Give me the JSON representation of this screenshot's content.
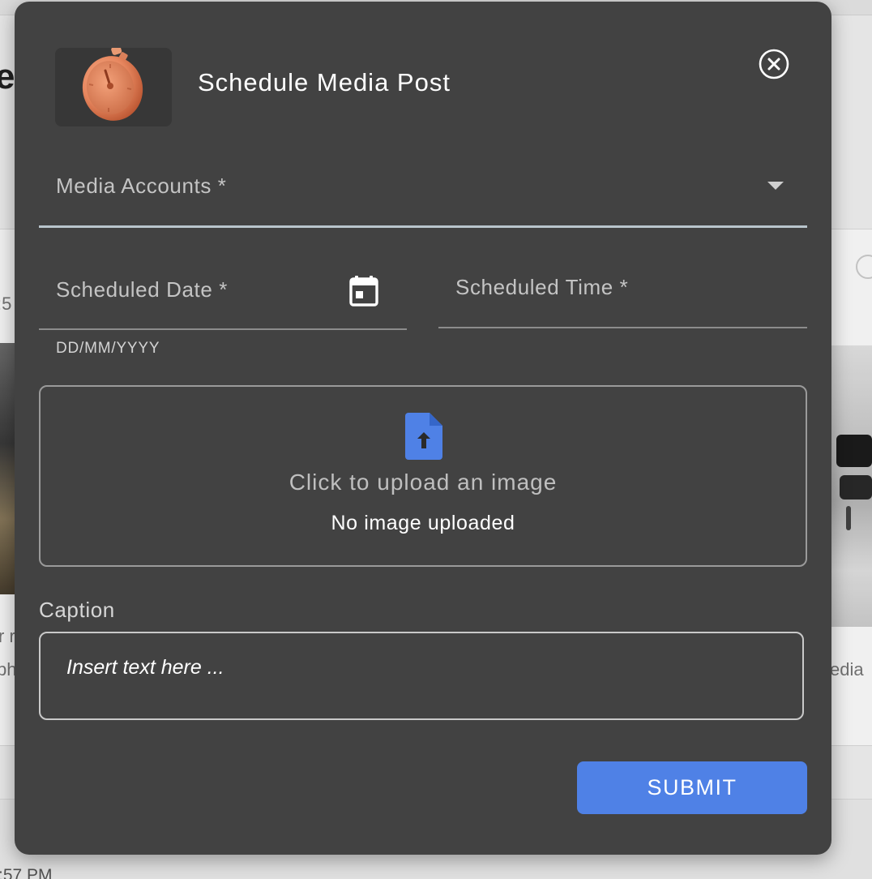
{
  "background": {
    "heading_fragment": "e",
    "left_texts": [
      ":5",
      "r r",
      "ph"
    ],
    "right_text": "edia",
    "footer_time": ":57 PM"
  },
  "dialog": {
    "header_icon": "stopwatch-icon",
    "title": "Schedule Media Post",
    "close_icon": "close-circle-icon",
    "media_accounts": {
      "label": "Media Accounts *",
      "value": "",
      "icon": "arrow-drop-down-icon"
    },
    "scheduled_date": {
      "label": "Scheduled Date *",
      "helper": "DD/MM/YYYY",
      "icon": "calendar-icon"
    },
    "scheduled_time": {
      "label": "Scheduled Time *"
    },
    "upload": {
      "icon": "file-upload-icon",
      "prompt": "Click to upload an image",
      "status": "No image uploaded"
    },
    "caption": {
      "label": "Caption",
      "placeholder": "Insert text here ...",
      "value": ""
    },
    "submit_label": "SUBMIT"
  },
  "colors": {
    "dialog_bg": "#424242",
    "accent": "#4f81e6",
    "upload_icon": "#4f81e6",
    "text_primary": "#ffffff",
    "text_secondary": "#c4c4c4",
    "select_underline": "#b9c5cc"
  }
}
